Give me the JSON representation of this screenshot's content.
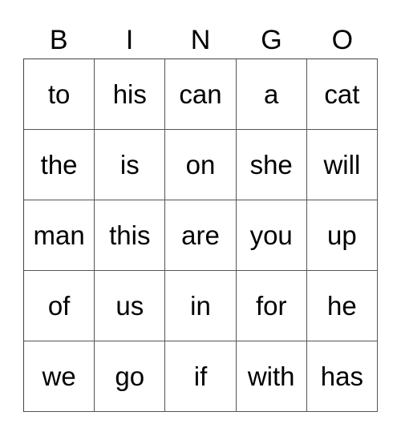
{
  "header": [
    "B",
    "I",
    "N",
    "G",
    "O"
  ],
  "rows": [
    [
      "to",
      "his",
      "can",
      "a",
      "cat"
    ],
    [
      "the",
      "is",
      "on",
      "she",
      "will"
    ],
    [
      "man",
      "this",
      "are",
      "you",
      "up"
    ],
    [
      "of",
      "us",
      "in",
      "for",
      "he"
    ],
    [
      "we",
      "go",
      "if",
      "with",
      "has"
    ]
  ]
}
